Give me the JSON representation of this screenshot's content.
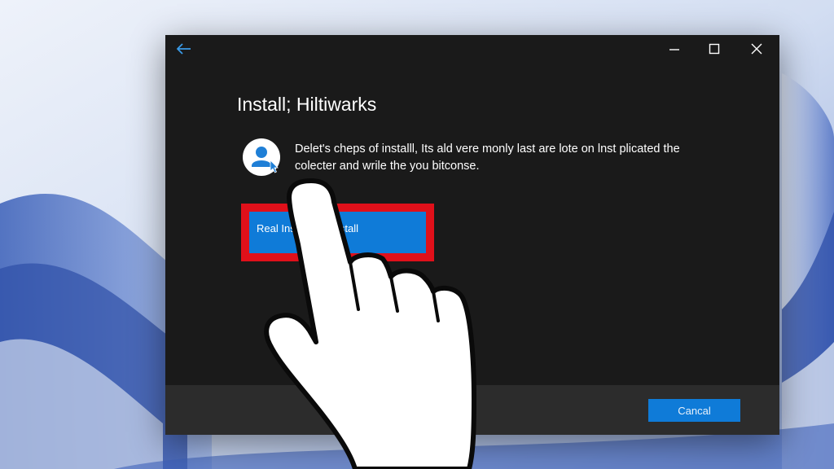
{
  "window": {
    "title": "Install; Hiltiwarks",
    "description": "Delet's cheps of installl, Its ald vere monly last are lote on lnst plicated the colecter and wrile the you bitconse.",
    "primary_button_label": "Real Ins... ...tar install",
    "cancel_label": "Cancal"
  },
  "icons": {
    "back": "back-arrow-icon",
    "minimize": "minimize-icon",
    "maximize": "maximize-icon",
    "close": "close-icon",
    "avatar": "user-avatar-icon",
    "pointer": "hand-pointer-icon"
  },
  "colors": {
    "window_bg": "#1a1a1a",
    "footer_bg": "#2c2c2c",
    "accent": "#0f7bd8",
    "highlight": "#e0101a"
  }
}
